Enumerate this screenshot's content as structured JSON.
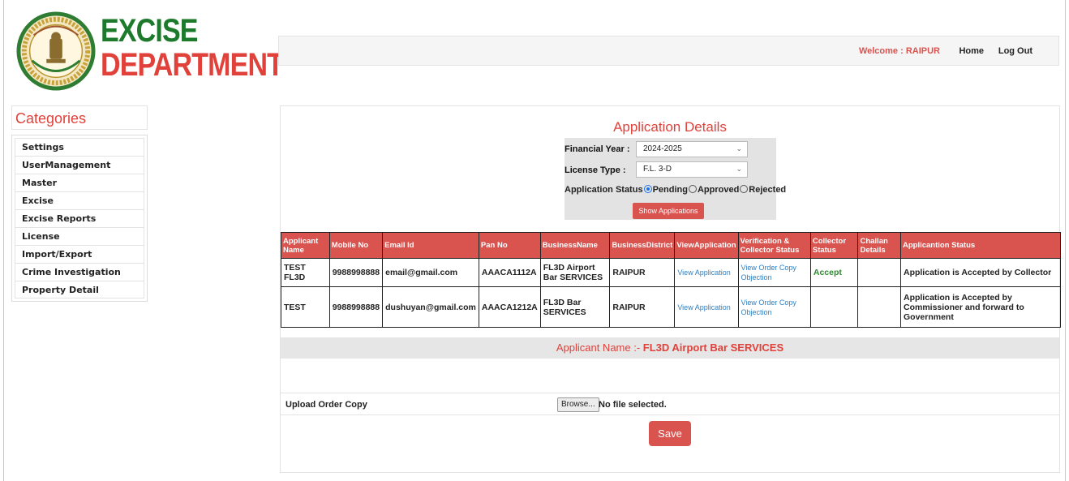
{
  "logo": {
    "line1": "EXCISE",
    "line2": "DEPARTMENT"
  },
  "topbar": {
    "welcome": "Welcome : RAIPUR",
    "home": "Home",
    "logout": "Log Out"
  },
  "sidebar": {
    "title": "Categories",
    "items": [
      "Settings",
      "UserManagement",
      "Master",
      "Excise",
      "Excise Reports",
      "License",
      "Import/Export",
      "Crime Investigation",
      "Property Detail"
    ]
  },
  "main": {
    "title": "Application Details",
    "filter": {
      "fy_label": "Financial Year :",
      "fy_value": "2024-2025",
      "lt_label": "License Type :",
      "lt_value": "F.L. 3-D",
      "status_label": "Application Status",
      "status_options": [
        "Pending",
        "Approved",
        "Rejected"
      ],
      "status_selected": "Pending",
      "show_button": "Show Applications"
    },
    "table": {
      "headers": [
        "Applicant Name",
        "Mobile No",
        "Email Id",
        "Pan No",
        "BusinessName",
        "BusinessDistrict",
        "ViewApplication",
        "Verification & Collector Status",
        "Collector Status",
        "Challan Details",
        "Applicantion Status"
      ],
      "rows": [
        {
          "applicant": "TEST FL3D",
          "mobile": "9988998888",
          "email": "email@gmail.com",
          "pan": "AAACA1112A",
          "business": "FL3D Airport Bar SERVICES",
          "district": "RAIPUR",
          "view": "View Application",
          "verification": "View Order Copy Objection",
          "collector": "Accept",
          "challan": "",
          "status": "Application is Accepted by Collector"
        },
        {
          "applicant": "TEST",
          "mobile": "9988998888",
          "email": "dushuyan@gmail.com",
          "pan": "AAACA1212A",
          "business": "FL3D Bar SERVICES",
          "district": "RAIPUR",
          "view": "View Application",
          "verification": "View Order Copy Objection",
          "collector": "",
          "challan": "",
          "status": "Application is Accepted by Commissioner and forward to Government"
        }
      ]
    },
    "applicant_bar": {
      "prefix": "Applicant Name :- ",
      "name": "FL3D Airport Bar SERVICES"
    },
    "upload": {
      "label": "Upload Order Copy",
      "browse": "Browse...",
      "file_status": "No file selected."
    },
    "save": "Save"
  },
  "colors": {
    "accent": "#d9534f",
    "logo_green": "#1d7a2c",
    "link": "#2f7fc1",
    "accept": "#2e8b2e"
  }
}
